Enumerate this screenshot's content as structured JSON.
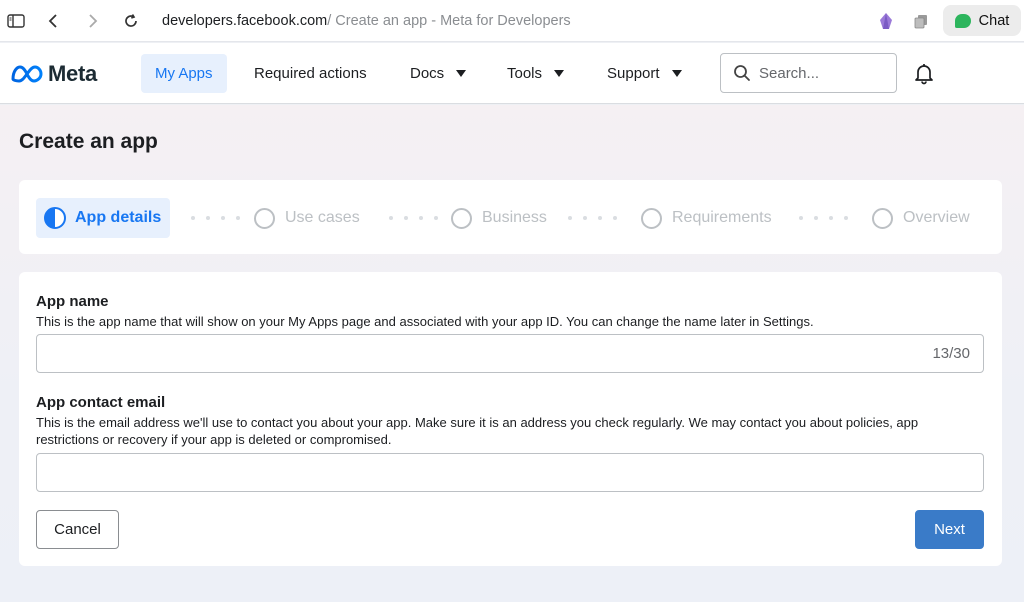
{
  "browser": {
    "url_domain": "developers.facebook.com",
    "url_rest": " / Create an app - Meta for Developers",
    "chat_label": "Chat"
  },
  "nav": {
    "logo_text": "Meta",
    "items": [
      {
        "label": "My Apps",
        "active": true
      },
      {
        "label": "Required actions"
      },
      {
        "label": "Docs",
        "dropdown": true
      },
      {
        "label": "Tools",
        "dropdown": true
      },
      {
        "label": "Support",
        "dropdown": true
      }
    ],
    "search_placeholder": "Search..."
  },
  "page": {
    "title": "Create an app"
  },
  "stepper": {
    "steps": [
      {
        "label": "App details",
        "active": true
      },
      {
        "label": "Use cases"
      },
      {
        "label": "Business"
      },
      {
        "label": "Requirements"
      },
      {
        "label": "Overview"
      }
    ]
  },
  "form": {
    "app_name": {
      "label": "App name",
      "help": "This is the app name that will show on your My Apps page and associated with your app ID. You can change the name later in Settings.",
      "value": "",
      "counter": "13/30"
    },
    "contact_email": {
      "label": "App contact email",
      "help": "This is the email address we'll use to contact you about your app. Make sure it is an address you check regularly. We may contact you about policies, app restrictions or recovery if your app is deleted or compromised.",
      "value": ""
    },
    "cancel_label": "Cancel",
    "next_label": "Next"
  },
  "colors": {
    "accent": "#1877f2",
    "next_button": "#3a7bc8",
    "chat_icon": "#2db55d"
  }
}
